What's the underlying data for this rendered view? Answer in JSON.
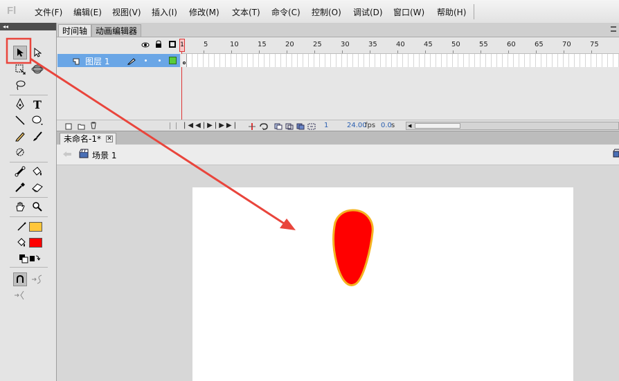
{
  "app": {
    "logo": "Fl"
  },
  "menu": [
    "文件(F)",
    "编辑(E)",
    "视图(V)",
    "插入(I)",
    "修改(M)",
    "文本(T)",
    "命令(C)",
    "控制(O)",
    "调试(D)",
    "窗口(W)",
    "帮助(H)"
  ],
  "toolpanel": {
    "collapse_glyph": "◂◂"
  },
  "tools": {
    "selection": "selection-tool",
    "subselection": "subselection-tool",
    "free_transform": "free-transform-tool",
    "3d_rotation": "3d-rotation-tool",
    "lasso": "lasso-tool",
    "pen": "pen-tool",
    "text_glyph": "T",
    "line": "line-tool",
    "oval": "oval-tool",
    "pencil": "pencil-tool",
    "brush": "brush-tool",
    "deco": "deco-tool",
    "bone": "bone-tool",
    "paint_bucket": "paint-bucket-tool",
    "eyedropper": "eyedropper-tool",
    "eraser": "eraser-tool",
    "hand": "hand-tool",
    "zoom": "zoom-tool"
  },
  "colors": {
    "stroke": "#ffc63a",
    "fill": "#ff0000",
    "shape_stroke": "#f5b321",
    "shape_fill": "#ff0000",
    "highlight": "#e9453c",
    "layer_color": "#59cc3b"
  },
  "timeline": {
    "tabs": [
      "时间轴",
      "动画编辑器"
    ],
    "ruler": [
      "1",
      "5",
      "10",
      "15",
      "20",
      "25",
      "30",
      "35",
      "40",
      "45",
      "50",
      "55",
      "60",
      "65",
      "70",
      "75"
    ],
    "layer_name": "图层 1",
    "current_frame": "1",
    "fps": "24.00",
    "fps_unit": "fps",
    "time": "0.0",
    "time_unit": "s"
  },
  "document": {
    "tab": "未命名-1*",
    "close_glyph": "✕",
    "scene": "场景 1"
  }
}
